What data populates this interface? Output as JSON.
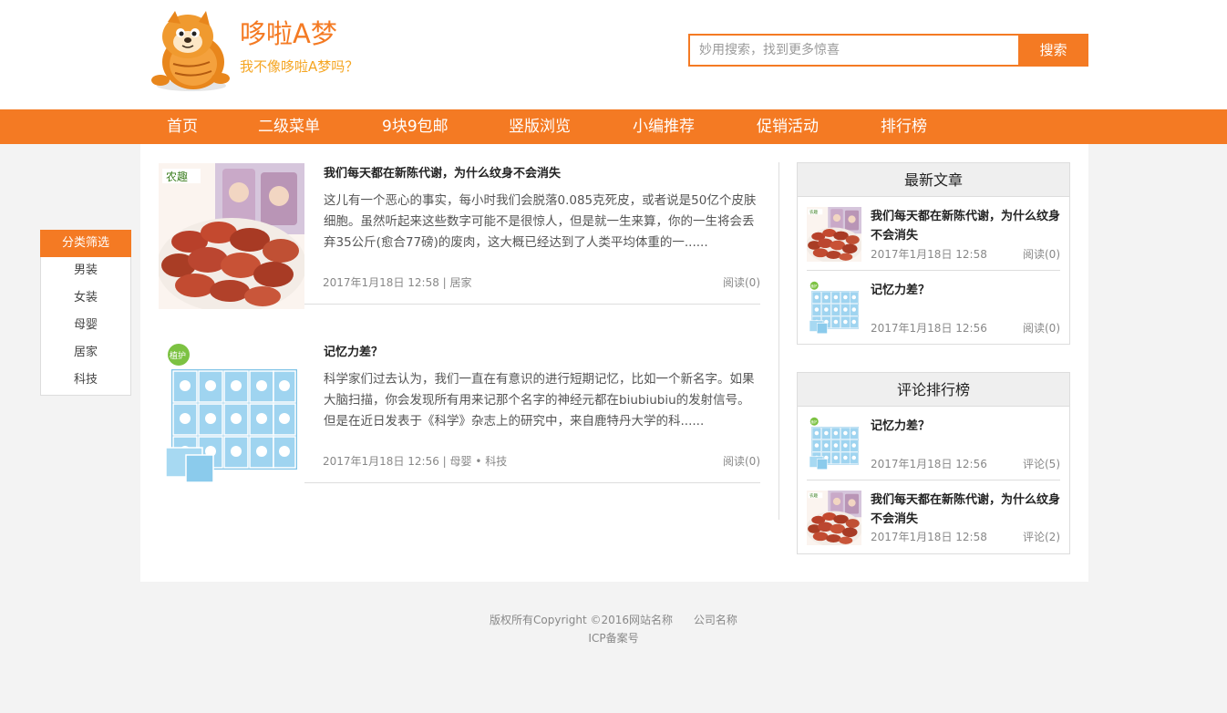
{
  "header": {
    "title": "哆啦A梦",
    "slogan": "我不像哆啦A梦吗？",
    "search_placeholder": "妙用搜索，找到更多惊喜",
    "search_button": "搜索",
    "logo_icon": "cat-mascot-icon"
  },
  "nav": {
    "items": [
      "首页",
      "二级菜单",
      "9块9包邮",
      "竖版浏览",
      "小编推荐",
      "促销活动",
      "排行榜"
    ]
  },
  "filter": {
    "title": "分类筛选",
    "categories": [
      "男装",
      "女装",
      "母婴",
      "居家",
      "科技"
    ]
  },
  "articles": [
    {
      "title": "我们每天都在新陈代谢，为什么纹身不会消失",
      "summary": "这儿有一个恶心的事实，每小时我们会脱落0.085克死皮，或者说是50亿个皮肤细胞。虽然听起来这些数字可能不是很惊人，但是就一生来算，你的一生将会丢弃35公斤(愈合77磅)的废肉，这大概已经达到了人类平均体重的一......",
      "meta": "2017年1月18日 12:58  |  居家",
      "reads": "阅读(0)",
      "thumb_icon": "dried-dates-image"
    },
    {
      "title": "记忆力差？",
      "summary": "科学家们过去认为，我们一直在有意识的进行短期记忆，比如一个新名字。如果大脑扫描，你会发现所有用来记那个名字的神经元都在biubiubiu的发射信号。但是在近日发表于《科学》杂志上的研究中，来自鹿特丹大学的科......",
      "meta": "2017年1月18日 12:56  |  母婴 • 科技",
      "reads": "阅读(0)",
      "thumb_icon": "tissue-boxes-image"
    }
  ],
  "latest": {
    "title": "最新文章",
    "items": [
      {
        "title": "我们每天都在新陈代谢，为什么纹身不会消失",
        "date": "2017年1月18日 12:58",
        "count": "阅读(0)"
      },
      {
        "title": "记忆力差？",
        "date": "2017年1月18日 12:56",
        "count": "阅读(0)"
      }
    ]
  },
  "ranking": {
    "title": "评论排行榜",
    "items": [
      {
        "title": "记忆力差？",
        "date": "2017年1月18日 12:56",
        "count": "评论(5)"
      },
      {
        "title": "我们每天都在新陈代谢，为什么纹身不会消失",
        "date": "2017年1月18日 12:58",
        "count": "评论(2)"
      }
    ]
  },
  "footer": {
    "line1": "版权所有Copyright ©2016网站名称      公司名称",
    "line2": "ICP备案号"
  },
  "colors": {
    "accent": "#f47a23",
    "slogan": "#f5a623",
    "background": "#f3f3f3"
  }
}
